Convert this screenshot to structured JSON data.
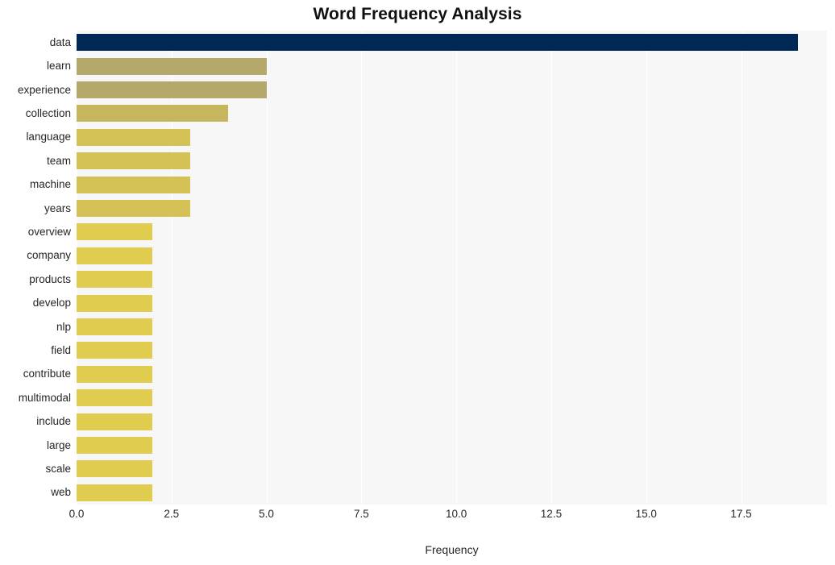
{
  "chart_data": {
    "type": "bar",
    "orientation": "horizontal",
    "title": "Word Frequency Analysis",
    "xlabel": "Frequency",
    "ylabel": "",
    "categories": [
      "data",
      "learn",
      "experience",
      "collection",
      "language",
      "team",
      "machine",
      "years",
      "overview",
      "company",
      "products",
      "develop",
      "nlp",
      "field",
      "contribute",
      "multimodal",
      "include",
      "large",
      "scale",
      "web"
    ],
    "values": [
      19,
      5,
      5,
      4,
      3,
      3,
      3,
      3,
      2,
      2,
      2,
      2,
      2,
      2,
      2,
      2,
      2,
      2,
      2,
      2
    ],
    "bar_colors": [
      "#002855",
      "#b5a86b",
      "#b5a86b",
      "#c6b75e",
      "#d4c257",
      "#d4c257",
      "#d4c257",
      "#d4c257",
      "#e0cc4f",
      "#e0cc4f",
      "#e0cc4f",
      "#e0cc4f",
      "#e0cc4f",
      "#e0cc4f",
      "#e0cc4f",
      "#e0cc4f",
      "#e0cc4f",
      "#e0cc4f",
      "#e0cc4f",
      "#e0cc4f"
    ],
    "x_ticks": [
      0.0,
      2.5,
      5.0,
      7.5,
      10.0,
      12.5,
      15.0,
      17.5
    ],
    "x_tick_labels": [
      "0.0",
      "2.5",
      "5.0",
      "7.5",
      "10.0",
      "12.5",
      "15.0",
      "17.5"
    ],
    "xlim": [
      0,
      19.76
    ],
    "grid": "vertical",
    "legend": "none",
    "plot_background": "#f7f7f7",
    "figure_background": "#ffffff",
    "gridline_color": "#ffffff",
    "text_color": "#262626"
  }
}
